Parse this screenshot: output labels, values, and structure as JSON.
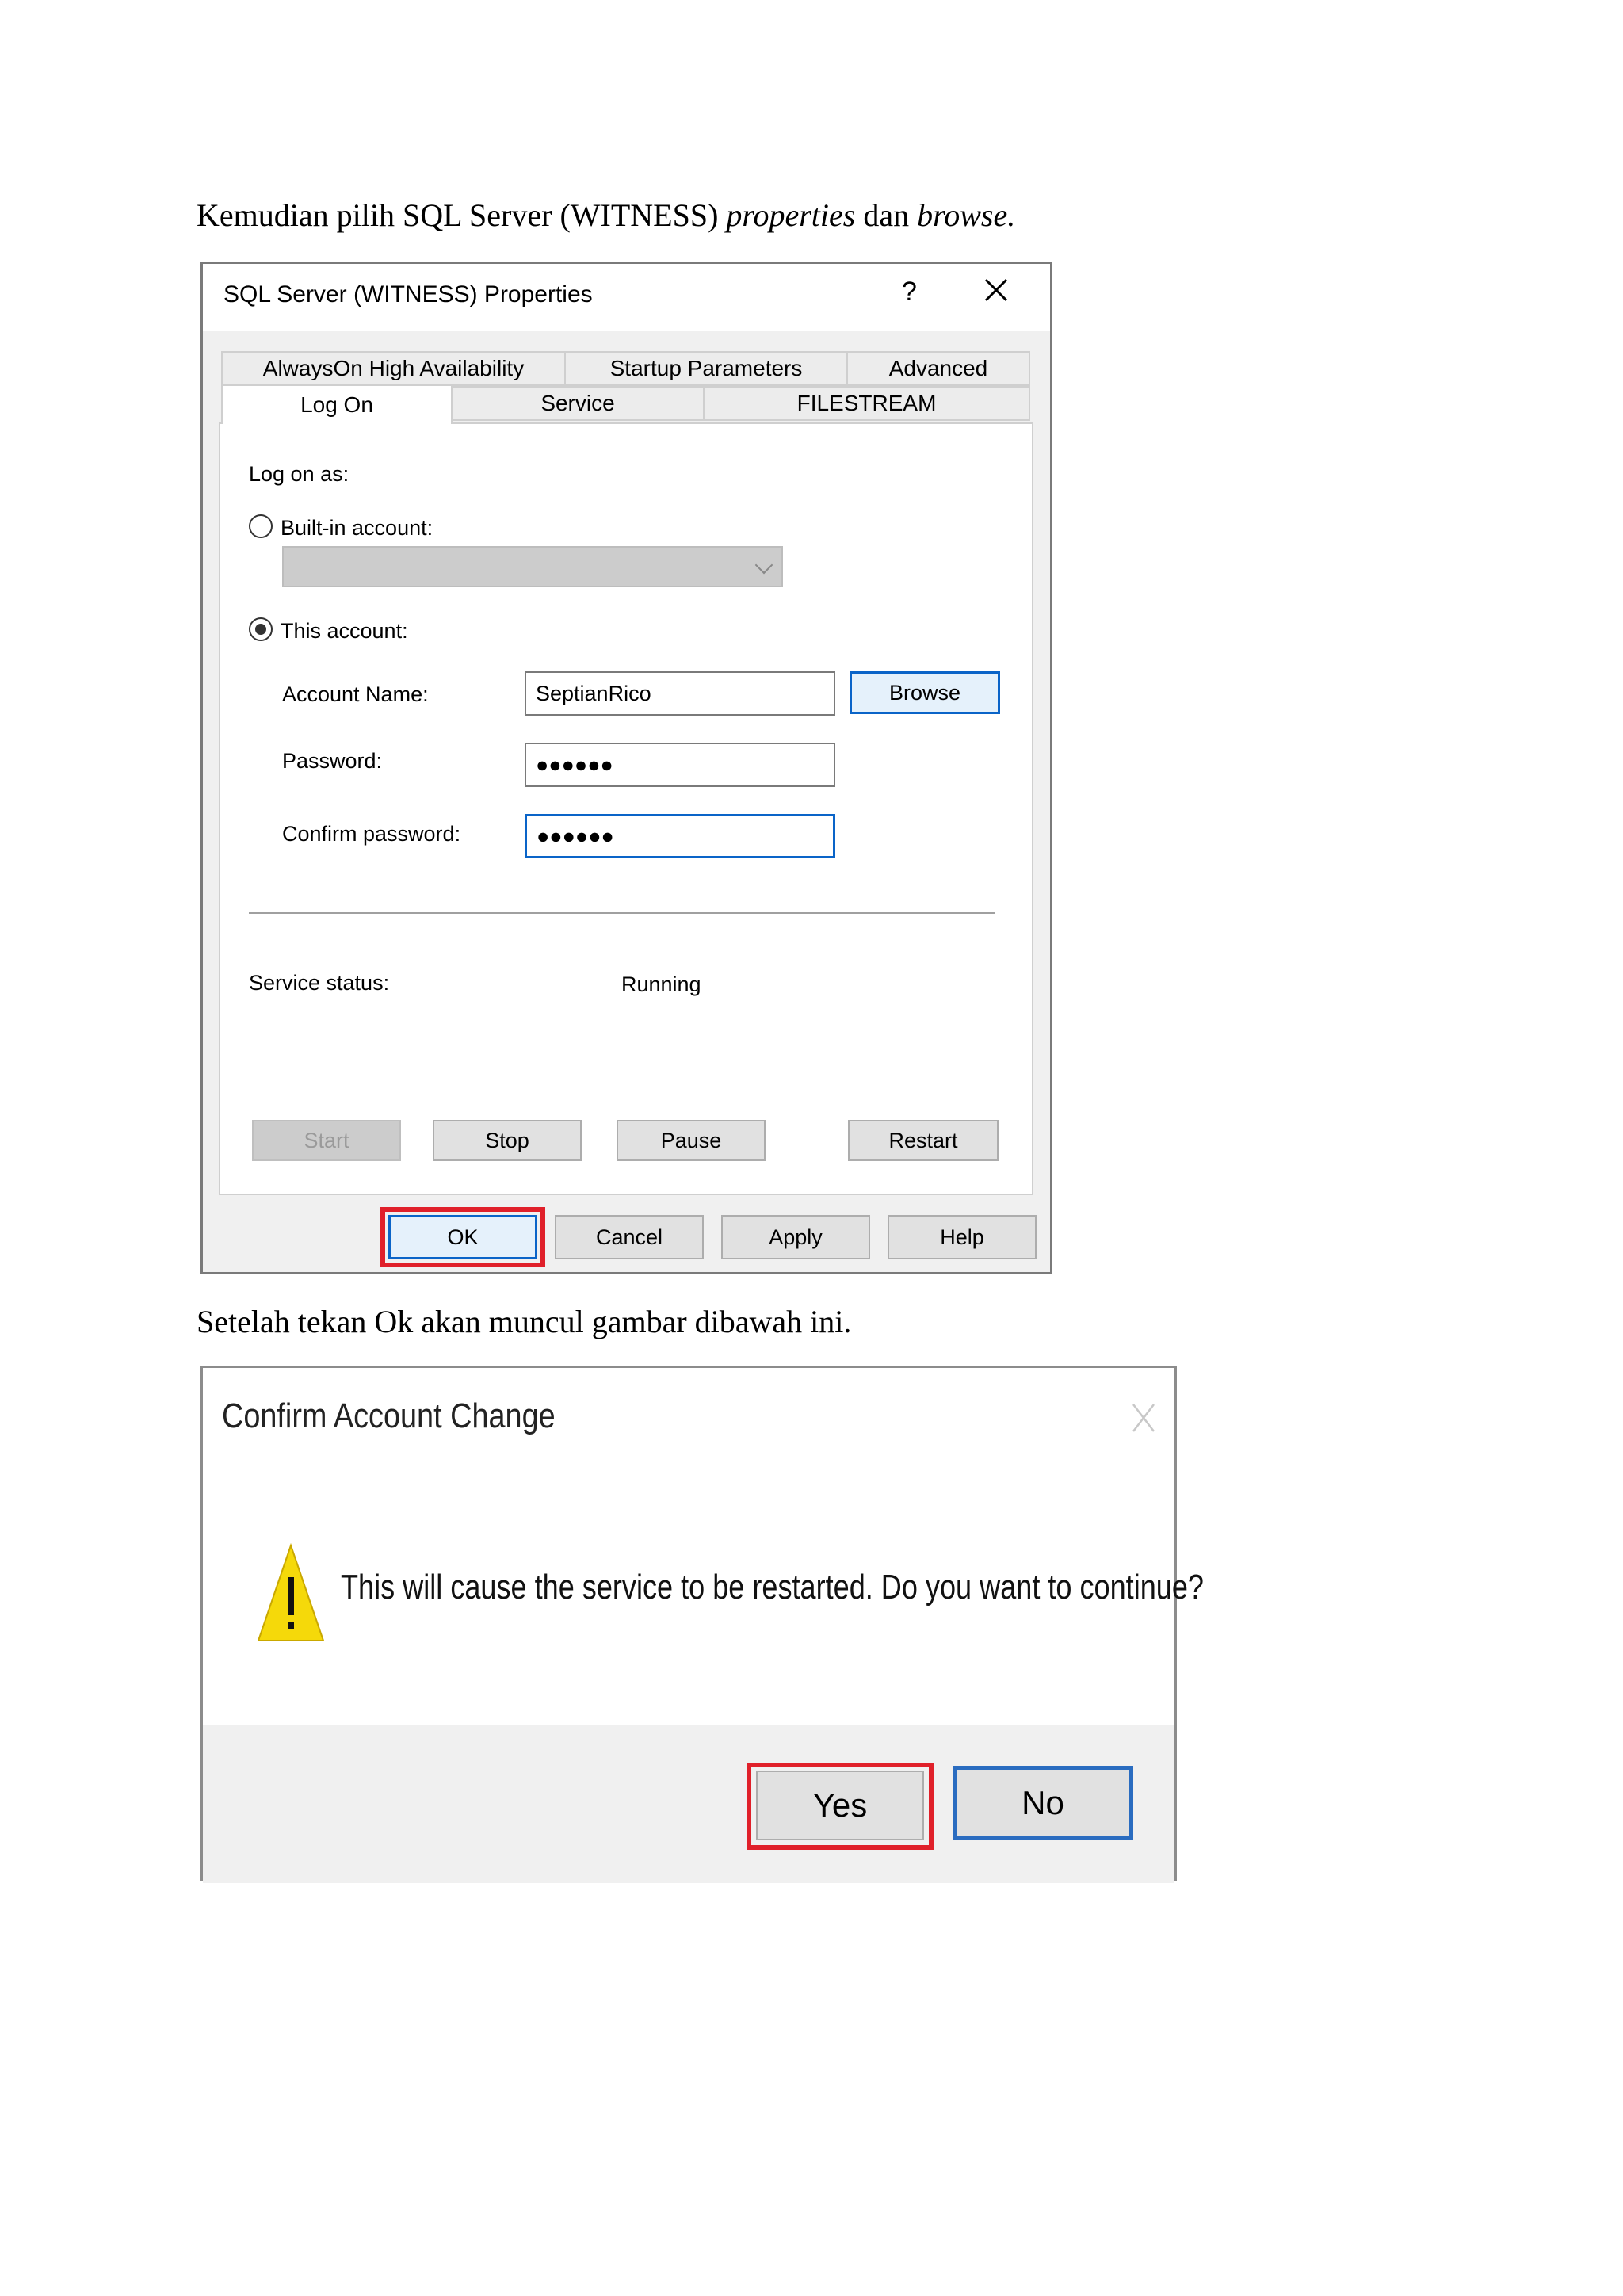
{
  "doc": {
    "para1_a": "Kemudian pilih SQL Server (WITNESS) ",
    "para1_b": "properties",
    "para1_c": " dan ",
    "para1_d": "browse.",
    "para2": "Setelah tekan Ok akan muncul gambar dibawah ini."
  },
  "props_dialog": {
    "title": "SQL Server (WITNESS) Properties",
    "help": "?",
    "tabs_row1": [
      "AlwaysOn High Availability",
      "Startup Parameters",
      "Advanced"
    ],
    "tabs_row2": [
      "Log On",
      "Service",
      "FILESTREAM"
    ],
    "log_on_as": "Log on as:",
    "builtin_account": "Built-in account:",
    "this_account": "This account:",
    "account_name_label": "Account Name:",
    "account_name_value": "SeptianRico",
    "browse": "Browse",
    "password_label": "Password:",
    "password_value": "●●●●●●",
    "confirm_label": "Confirm password:",
    "confirm_value": "●●●●●●",
    "service_status_label": "Service status:",
    "service_status_value": "Running",
    "start": "Start",
    "stop": "Stop",
    "pause": "Pause",
    "restart": "Restart",
    "ok": "OK",
    "cancel": "Cancel",
    "apply": "Apply",
    "help_button": "Help"
  },
  "confirm_dialog": {
    "title": "Confirm Account Change",
    "message": "This will cause the service to be restarted. Do you want to continue?",
    "yes": "Yes",
    "no": "No",
    "icon": "warning-icon"
  },
  "colors": {
    "highlight": "#e0202a",
    "focus_blue": "#0a64c8",
    "warning_yellow": "#f5d90a"
  }
}
